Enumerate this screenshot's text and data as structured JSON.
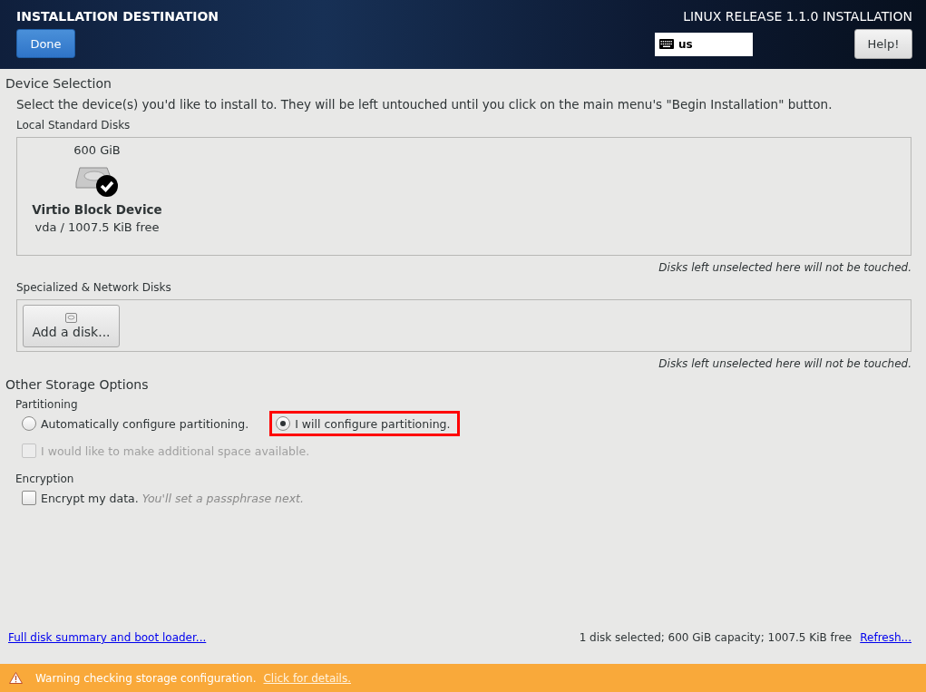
{
  "header": {
    "title": "INSTALLATION DESTINATION",
    "done_button": "Done",
    "product": "LINUX RELEASE 1.1.0 INSTALLATION",
    "keyboard_layout": "us",
    "help_button": "Help!"
  },
  "device_selection": {
    "title": "Device Selection",
    "description": "Select the device(s) you'd like to install to.  They will be left untouched until you click on the main menu's \"Begin Installation\" button.",
    "local_disks": {
      "label": "Local Standard Disks",
      "disks": [
        {
          "size": "600 GiB",
          "name": "Virtio Block Device",
          "device": "vda",
          "separator": "/",
          "free": "1007.5 KiB free",
          "selected": true
        }
      ],
      "hint": "Disks left unselected here will not be touched."
    },
    "network_disks": {
      "label": "Specialized & Network Disks",
      "add_button": "Add a disk...",
      "hint": "Disks left unselected here will not be touched."
    }
  },
  "other_storage": {
    "title": "Other Storage Options",
    "partitioning": {
      "label": "Partitioning",
      "options": [
        {
          "label": "Automatically configure partitioning.",
          "selected": false,
          "highlighted": false
        },
        {
          "label": "I will configure partitioning.",
          "selected": true,
          "highlighted": true
        }
      ],
      "additional_space": {
        "label": "I would like to make additional space available.",
        "checked": false,
        "disabled": true
      }
    },
    "encryption": {
      "label": "Encryption",
      "encrypt": {
        "label": "Encrypt my data.",
        "note": "You'll set a passphrase next.",
        "checked": false,
        "disabled": false
      }
    }
  },
  "footer": {
    "summary_link": "Full disk summary and boot loader...",
    "status": "1 disk selected; 600 GiB capacity; 1007.5 KiB free",
    "refresh_link": "Refresh..."
  },
  "warning_bar": {
    "message": "Warning checking storage configuration.",
    "link": "Click for details."
  }
}
